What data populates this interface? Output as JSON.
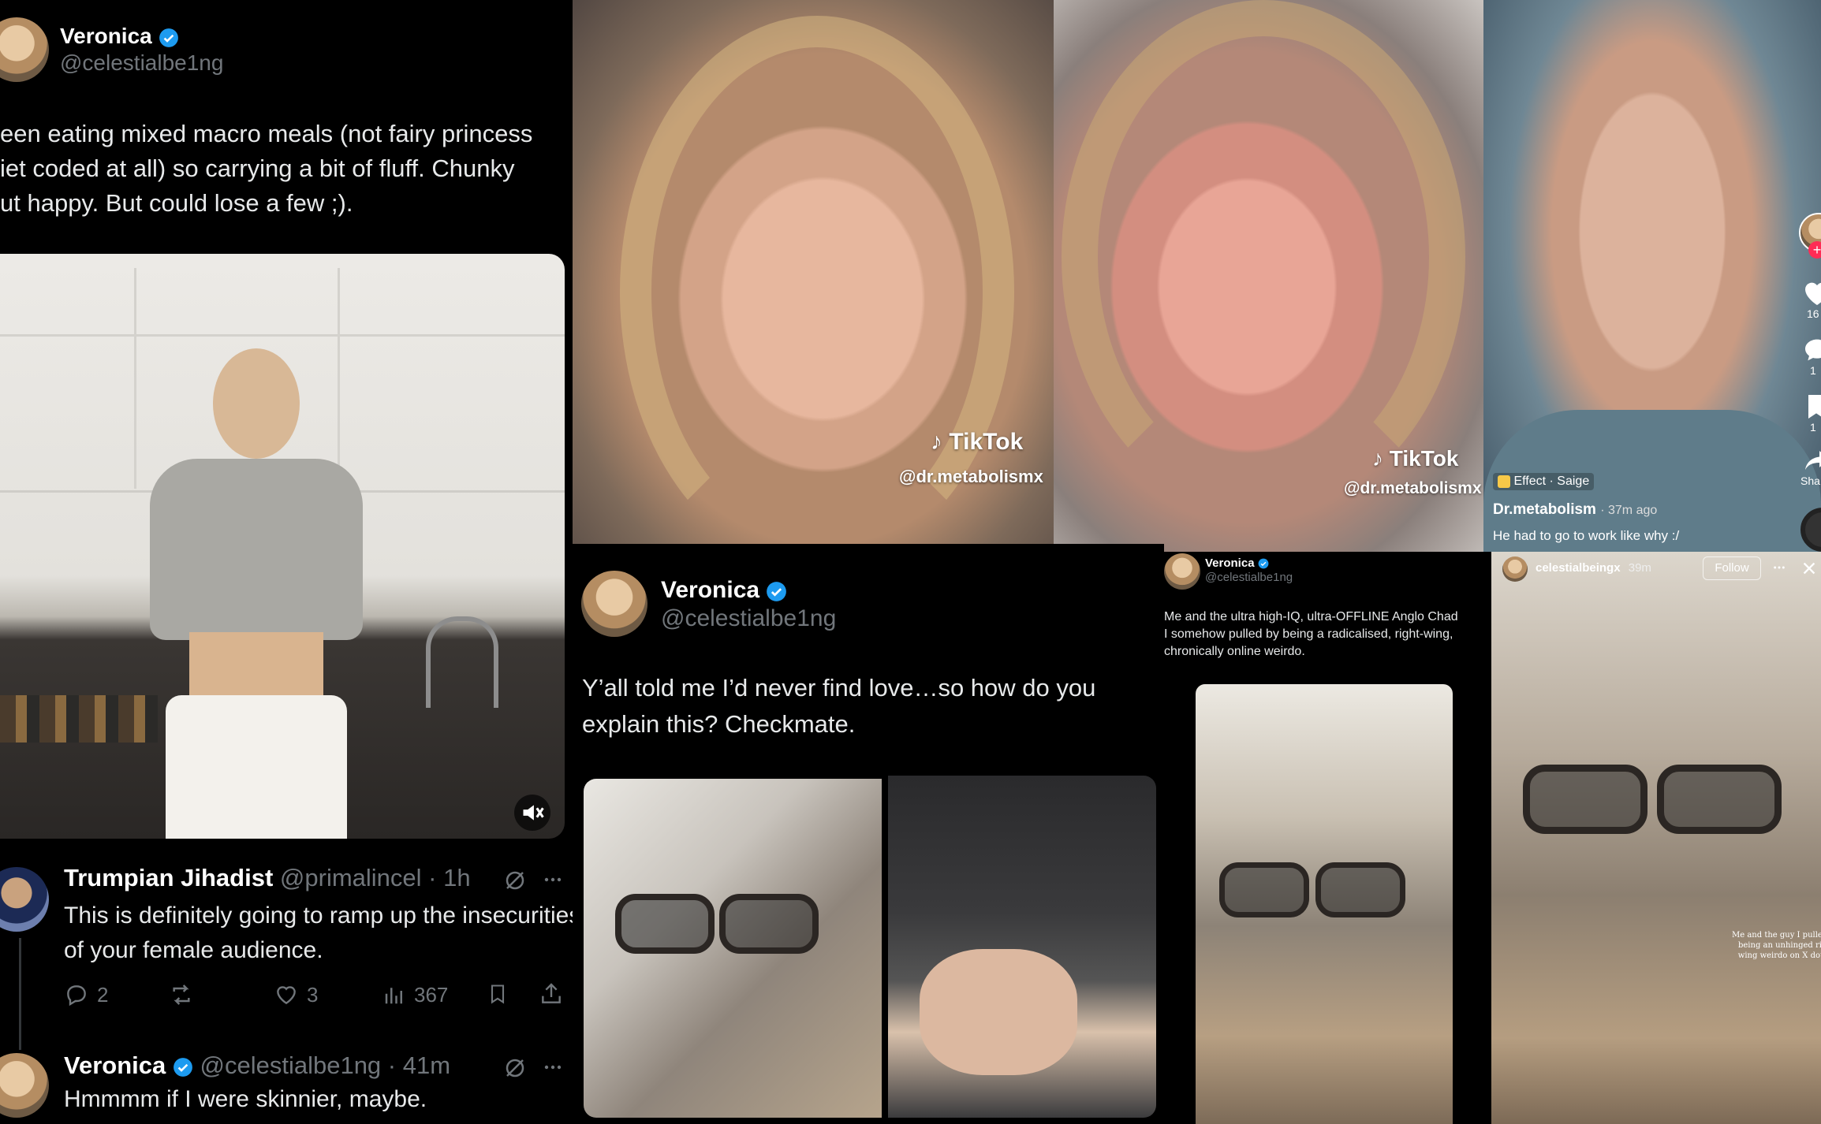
{
  "tweet_top": {
    "name": "Veronica",
    "handle": "@celestialbe1ng",
    "text_lines": [
      "een eating mixed macro meals (not fairy princess",
      "iet coded at all) so carrying a bit of fluff. Chunky",
      "ut happy. But could lose a few ;)."
    ]
  },
  "reply1": {
    "name": "Trumpian Jihadist",
    "handle": "@primalincel",
    "time": "· 1h",
    "text_lines": [
      "This is definitely going to ramp up the insecurities",
      "of your female audience."
    ],
    "replies": "2",
    "likes": "3",
    "views": "367"
  },
  "reply2": {
    "name": "Veronica",
    "handle": "@celestialbe1ng",
    "time": "· 41m",
    "text": "Hmmmm if I were skinnier, maybe."
  },
  "tiktok1": {
    "brand": "TikTok",
    "user": "@dr.metabolismx"
  },
  "tiktok2": {
    "brand": "TikTok",
    "user": "@dr.metabolismx"
  },
  "tiktok3": {
    "effect": "Effect · Saige",
    "user": "Dr.metabolism",
    "time": "· 37m ago",
    "caption": "He had to go to work like why :/",
    "side_counts": [
      "16",
      "1",
      "1"
    ],
    "share": "Sha"
  },
  "tweet_center": {
    "name": "Veronica",
    "handle": "@celestialbe1ng",
    "text_lines": [
      "Y’all told me I’d never find love…so how do you",
      "explain this? Checkmate."
    ]
  },
  "tweet_small": {
    "name": "Veronica",
    "handle": "@celestialbe1ng",
    "text_lines": [
      "Me and the ultra high-IQ, ultra-OFFLINE Anglo Chad",
      "I somehow pulled by being a radicalised, right-wing,",
      "chronically online weirdo."
    ]
  },
  "story": {
    "user": "celestialbeingx",
    "time": "39m",
    "follow": "Follow",
    "overlay_lines": [
      "Me and the guy I pulled b",
      "being an unhinged right",
      "wing weirdo on X dot co"
    ]
  },
  "colors": {
    "verified": "#1d9bf0",
    "muted": "#71767b",
    "tiktok_red": "#fe2c55"
  }
}
